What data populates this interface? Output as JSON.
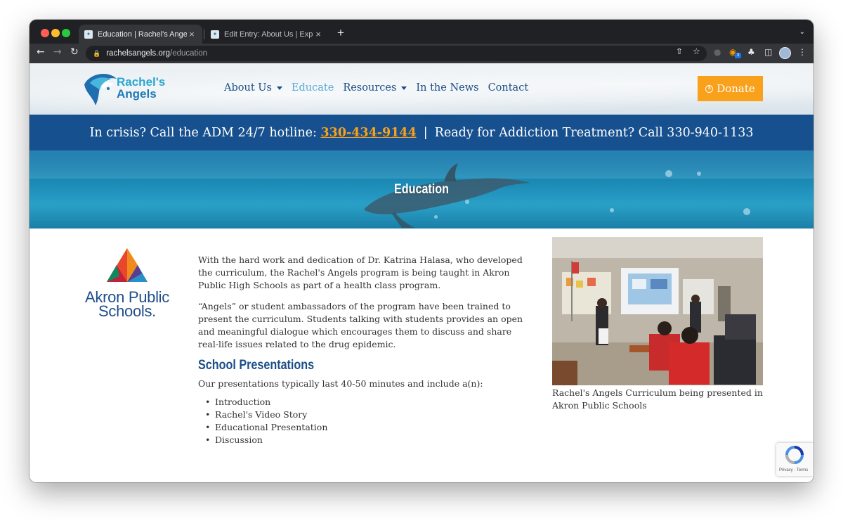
{
  "browser": {
    "tabs": [
      {
        "title": "Education | Rachel's Angels",
        "active": true
      },
      {
        "title": "Edit Entry: About Us | Expressi",
        "active": false
      }
    ],
    "address": {
      "host": "rachelsangels.org",
      "path": "/education"
    },
    "extension_badge": "3"
  },
  "site": {
    "logo": {
      "line1": "Rachel's",
      "line2": "Angels"
    },
    "nav": [
      {
        "label": "About Us",
        "dropdown": true,
        "active": false
      },
      {
        "label": "Educate",
        "dropdown": false,
        "active": true
      },
      {
        "label": "Resources",
        "dropdown": true,
        "active": false
      },
      {
        "label": "In the News",
        "dropdown": false,
        "active": false
      },
      {
        "label": "Contact",
        "dropdown": false,
        "active": false
      }
    ],
    "donate_label": "Donate",
    "crisis": {
      "prefix": "In crisis? Call the ADM 24/7 hotline:",
      "hotline": "330-434-9144",
      "separator": "|",
      "treatment": "Ready for Addiction Treatment? Call 330-940-1133"
    },
    "hero_title": "Education",
    "partner_logo": {
      "line1": "Akron Public",
      "line2": "Schools."
    },
    "article": {
      "p1": "With the hard work and dedication of Dr. Katrina Halasa, who developed the curriculum, the Rachel's Angels program is being taught in Akron Public High Schools as part of a health class program.",
      "p2": "“Angels” or student ambassadors of the program have been trained to present the curriculum. Students talking with students provides an open and meaningful dialogue which encourages them to discuss and share real-life issues related to the drug epidemic.",
      "heading": "School Presentations",
      "p3": "Our presentations typically last 40-50 minutes and include a(n):",
      "list": [
        "Introduction",
        "Rachel's Video Story",
        "Educational Presentation",
        "Discussion"
      ]
    },
    "photo_caption": "Rachel's Angels Curriculum being presented in Akron Public Schools",
    "recaptcha_label": "Privacy - Terms"
  },
  "colors": {
    "nav_text": "#1b4e87",
    "nav_active": "#5ba8d8",
    "donate_bg": "#f9a11b",
    "crisis_bg": "#17508e",
    "hotline": "#f9a11b"
  }
}
